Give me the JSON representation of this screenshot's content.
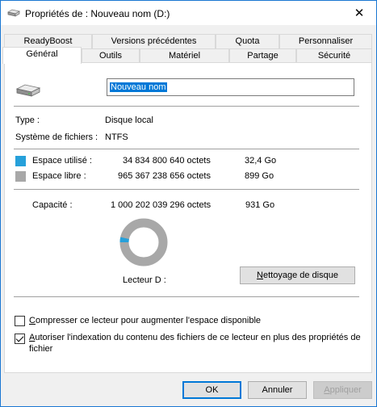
{
  "window": {
    "title": "Propriétés de : Nouveau nom (D:)",
    "close_glyph": "✕"
  },
  "tabs": {
    "row1": [
      "ReadyBoost",
      "Versions précédentes",
      "Quota",
      "Personnaliser"
    ],
    "row2": [
      "Général",
      "Outils",
      "Matériel",
      "Partage",
      "Sécurité"
    ],
    "active": "Général"
  },
  "general": {
    "drive_name": "Nouveau nom",
    "type_label": "Type :",
    "type_value": "Disque local",
    "fs_label": "Système de fichiers :",
    "fs_value": "NTFS",
    "used_label": "Espace utilisé :",
    "used_bytes": "34 834 800 640 octets",
    "used_size": "32,4 Go",
    "free_label": "Espace libre :",
    "free_bytes": "965 367 238 656 octets",
    "free_size": "899 Go",
    "capacity_label": "Capacité :",
    "capacity_bytes": "1 000 202 039 296 octets",
    "capacity_size": "931 Go",
    "drive_label": "Lecteur D :",
    "cleanup_prefix": "N",
    "cleanup_rest": "ettoyage de disque",
    "used_fraction": 0.0348,
    "colors": {
      "used": "#26a0da",
      "free": "#a8a8a8"
    },
    "compress_prefix": "C",
    "compress_rest": "ompresser ce lecteur pour augmenter l'espace disponible",
    "compress_checked": false,
    "index_prefix": "A",
    "index_rest": "utoriser l'indexation du contenu des fichiers de ce lecteur en plus des propriétés de",
    "index_line2": "fichier",
    "index_checked": true
  },
  "buttons": {
    "ok": "OK",
    "cancel": "Annuler",
    "apply_prefix": "A",
    "apply_rest": "ppliquer"
  }
}
